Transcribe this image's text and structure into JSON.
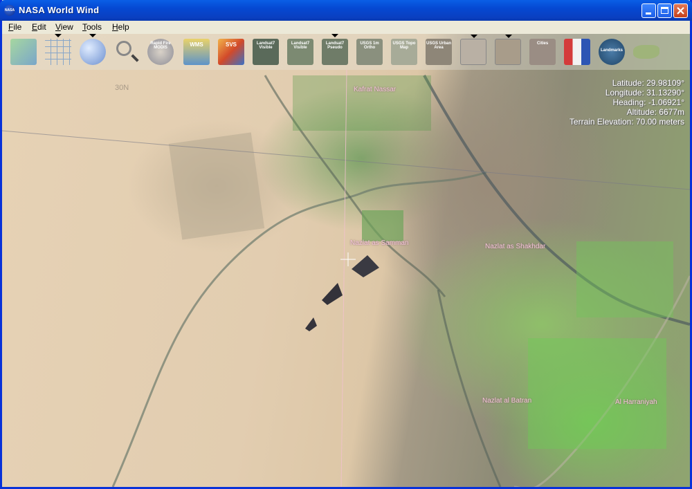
{
  "window": {
    "title": "NASA World Wind",
    "app_icon": "nasa-logo-icon"
  },
  "menubar": [
    {
      "label": "File",
      "mnemonic": "F",
      "rest": "ile"
    },
    {
      "label": "Edit",
      "mnemonic": "E",
      "rest": "dit"
    },
    {
      "label": "View",
      "mnemonic": "V",
      "rest": "iew"
    },
    {
      "label": "Tools",
      "mnemonic": "T",
      "rest": "ools"
    },
    {
      "label": "Help",
      "mnemonic": "H",
      "rest": "elp"
    }
  ],
  "toolbar": {
    "layers_icon": "layers-icon",
    "grid_icon": "latlon-grid-icon",
    "globe_icon": "globe-icon",
    "search_icon": "magnifier-icon",
    "modis_label": "Rapid Fire MODIS",
    "wms_label": "WMS",
    "svs_label": "SVS",
    "landsat_visible_label": "Landsat7 Visible",
    "landsat_visible2_label": "Landsat7 Visible",
    "landsat_pseudo_label": "Landsat7 Pseudo",
    "usgs_ortho_label": "USGS 1m Ortho",
    "usgs_topo_label": "USGS Topo Map",
    "usgs_urban_label": "USGS Urban Area",
    "boundaries_icon": "boundaries-icon",
    "placenames_icon": "placenames-icon",
    "cities_label": "Cities",
    "flags_icon": "flags-icon",
    "landmarks_label": "Landmarks",
    "usa_map_icon": "usa-map-icon"
  },
  "readout": {
    "latitude": "Latitude: 29.98109°",
    "longitude": "Longitude: 31.13290°",
    "heading": "Heading: -1.06921°",
    "altitude": "Altitude: 6677m",
    "terrain": "Terrain Elevation: 70.00 meters"
  },
  "map": {
    "grid_label": "30N",
    "places": {
      "kafrat": "Kafrat Nassar",
      "samman": "Nazlat as Samman",
      "shakhdar": "Nazlat as Shakhdar",
      "nazlat_bottom": "Nazlat al Batran",
      "harraniyah": "Al Harraniyah"
    }
  }
}
